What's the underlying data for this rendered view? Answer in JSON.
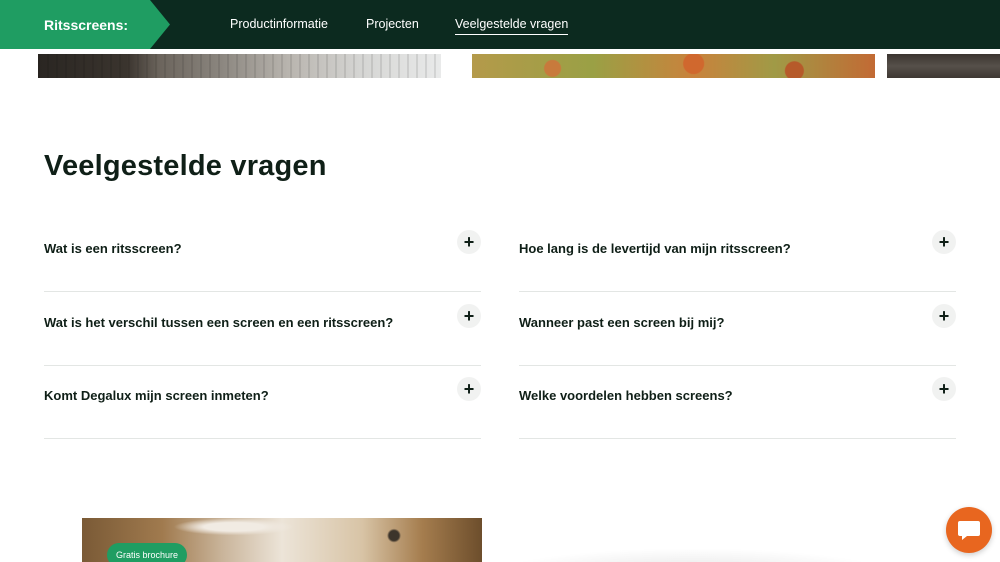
{
  "header": {
    "brand": "Ritsscreens:",
    "nav": [
      {
        "label": "Productinformatie",
        "active": false
      },
      {
        "label": "Projecten",
        "active": false
      },
      {
        "label": "Veelgestelde vragen",
        "active": true
      }
    ]
  },
  "faq": {
    "title": "Veelgestelde vragen",
    "toggle_symbol": "+",
    "left": [
      "Wat is een ritsscreen?",
      "Wat is het verschil tussen een screen en een ritsscreen?",
      "Komt Degalux mijn screen inmeten?"
    ],
    "right": [
      "Hoe lang is de levertijd van mijn ritsscreen?",
      "Wanneer past een screen bij mij?",
      "Welke voordelen hebben screens?"
    ]
  },
  "brochure": {
    "badge": "Gratis brochure"
  },
  "chat": {
    "icon": "chat-bubble-icon"
  },
  "colors": {
    "topbar": "#0c2a1f",
    "brand": "#1f9d62",
    "chat": "#e8661f"
  }
}
